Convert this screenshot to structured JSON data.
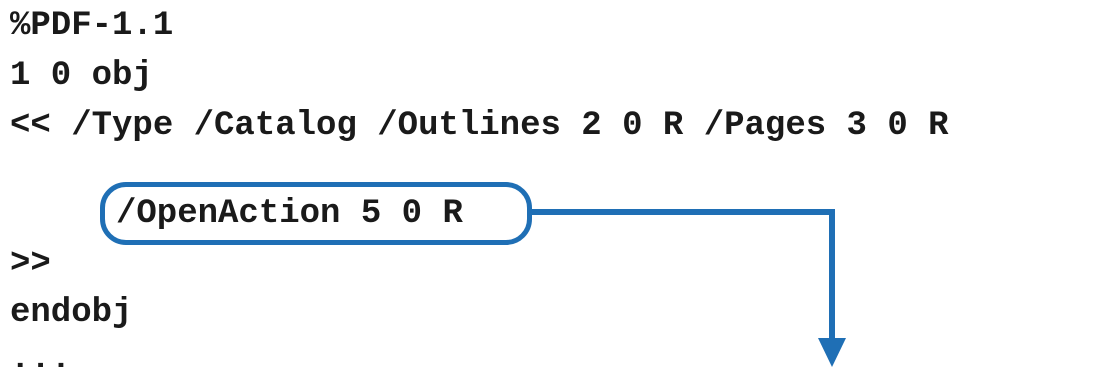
{
  "code": {
    "line1": "%PDF-1.1",
    "line2": "1 0 obj",
    "line3": "<< /Type /Catalog /Outlines 2 0 R /Pages 3 0 R",
    "highlighted": "/OpenAction 5 0 R",
    "line5": ">>",
    "line6": "endobj",
    "line7": "..."
  },
  "colors": {
    "accent": "#1f6fb5",
    "text": "#1a1a1a",
    "background": "#ffffff"
  }
}
